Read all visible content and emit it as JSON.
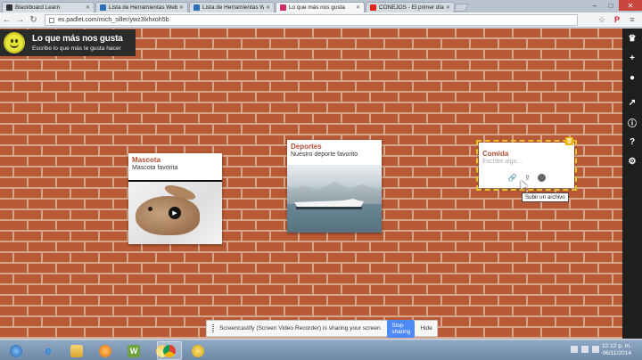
{
  "browser": {
    "tabs": [
      {
        "label": "Blackboard Learn",
        "favicon_color": "#333333",
        "active": false
      },
      {
        "label": "Lista de Herramientas Web",
        "favicon_color": "#2f6fb3",
        "active": false
      },
      {
        "label": "Lista de Herramientas Web",
        "favicon_color": "#2f6fb3",
        "active": false
      },
      {
        "label": "Lo que más nos gusta",
        "favicon_color": "#d22b6e",
        "active": true
      },
      {
        "label": "CONEJOS - El primer día de",
        "favicon_color": "#e62117",
        "active": false
      }
    ],
    "url": "es.padlet.com/mich_siller/ywz3lxhxoh5b"
  },
  "padlet": {
    "title": "Lo que más nos gusta",
    "subtitle": "Escribe lo que más te gusta hacer",
    "posts": [
      {
        "title": "Mascota",
        "body": "Mascota favorita",
        "media": "rabbit-video"
      },
      {
        "title": "Deportes",
        "body": "Nuestro deporte favorito",
        "media": "cruise-ship-photo"
      },
      {
        "title": "Comida",
        "placeholder": "Escribe algo..."
      }
    ],
    "tooltip": "Subir un archivo"
  },
  "sidebar": {
    "icons": [
      "crown-icon",
      "plus-icon",
      "user-icon",
      "share-icon",
      "info-icon",
      "help-icon",
      "gear-icon"
    ]
  },
  "share_bar": {
    "message": "Screencastify (Screen Video Recorder) is sharing your screen.",
    "stop_label": "Stop sharing",
    "hide_label": "Hide"
  },
  "taskbar": {
    "time": "12:12 p. m.",
    "date": "06/11/2014"
  },
  "colors": {
    "brick": "#b85a35",
    "post_title": "#b14c34",
    "accent_yellow": "#f0b400",
    "stop_button": "#4c8bf5"
  }
}
